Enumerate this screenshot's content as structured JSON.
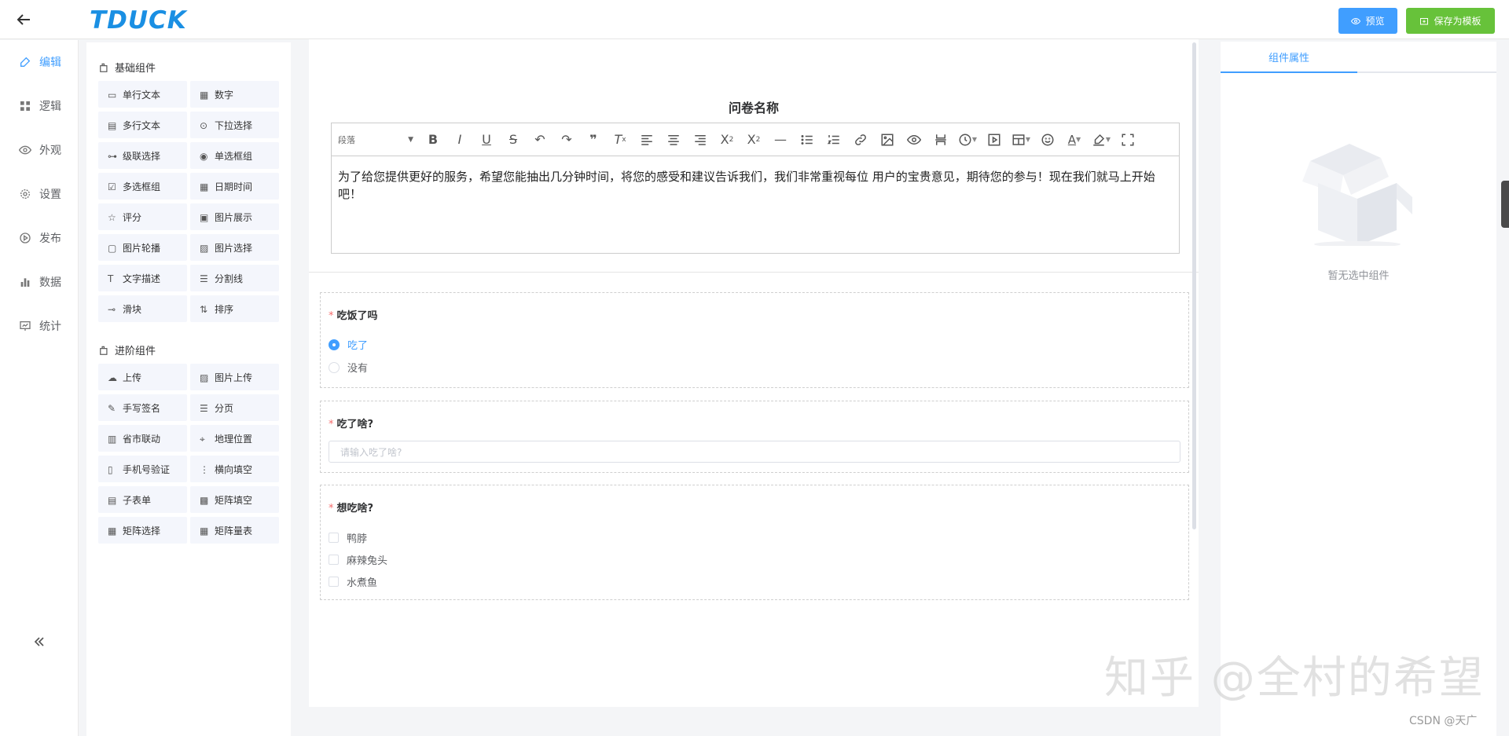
{
  "header": {
    "logo": "TDUCK",
    "preview_label": "预览",
    "save_template_label": "保存为模板"
  },
  "nav": {
    "items": [
      {
        "label": "编辑",
        "icon": "edit-icon",
        "active": true
      },
      {
        "label": "逻辑",
        "icon": "grid-icon",
        "active": false
      },
      {
        "label": "外观",
        "icon": "eye-icon",
        "active": false
      },
      {
        "label": "设置",
        "icon": "gear-icon",
        "active": false
      },
      {
        "label": "发布",
        "icon": "play-icon",
        "active": false
      },
      {
        "label": "数据",
        "icon": "bar-chart-icon",
        "active": false
      },
      {
        "label": "统计",
        "icon": "stats-icon",
        "active": false
      }
    ]
  },
  "components": {
    "basic_title": "基础组件",
    "basic": [
      "单行文本",
      "数字",
      "多行文本",
      "下拉选择",
      "级联选择",
      "单选框组",
      "多选框组",
      "日期时间",
      "评分",
      "图片展示",
      "图片轮播",
      "图片选择",
      "文字描述",
      "分割线",
      "滑块",
      "排序"
    ],
    "advanced_title": "进阶组件",
    "advanced": [
      "上传",
      "图片上传",
      "手写签名",
      "分页",
      "省市联动",
      "地理位置",
      "手机号验证",
      "横向填空",
      "子表单",
      "矩阵填空",
      "矩阵选择",
      "矩阵量表"
    ]
  },
  "form": {
    "title": "问卷名称",
    "editor_paragraph": "段落",
    "description": "为了给您提供更好的服务，希望您能抽出几分钟时间，将您的感受和建议告诉我们，我们非常重视每位 用户的宝贵意见，期待您的参与！现在我们就马上开始吧！",
    "questions": [
      {
        "title": "吃饭了吗",
        "type": "radio",
        "options": [
          "吃了",
          "没有"
        ],
        "selected": "吃了"
      },
      {
        "title": "吃了啥?",
        "type": "input",
        "placeholder": "请输入吃了啥?"
      },
      {
        "title": "想吃啥?",
        "type": "checkbox",
        "options": [
          "鸭脖",
          "麻辣兔头",
          "水煮鱼"
        ]
      }
    ]
  },
  "properties": {
    "tab_label": "组件属性",
    "empty_text": "暂无选中组件"
  },
  "watermark": "知乎 @全村的希望",
  "footer_mark": "CSDN @天广",
  "colors": {
    "primary": "#409eff",
    "success": "#67c23a",
    "required": "#f56c6c"
  }
}
